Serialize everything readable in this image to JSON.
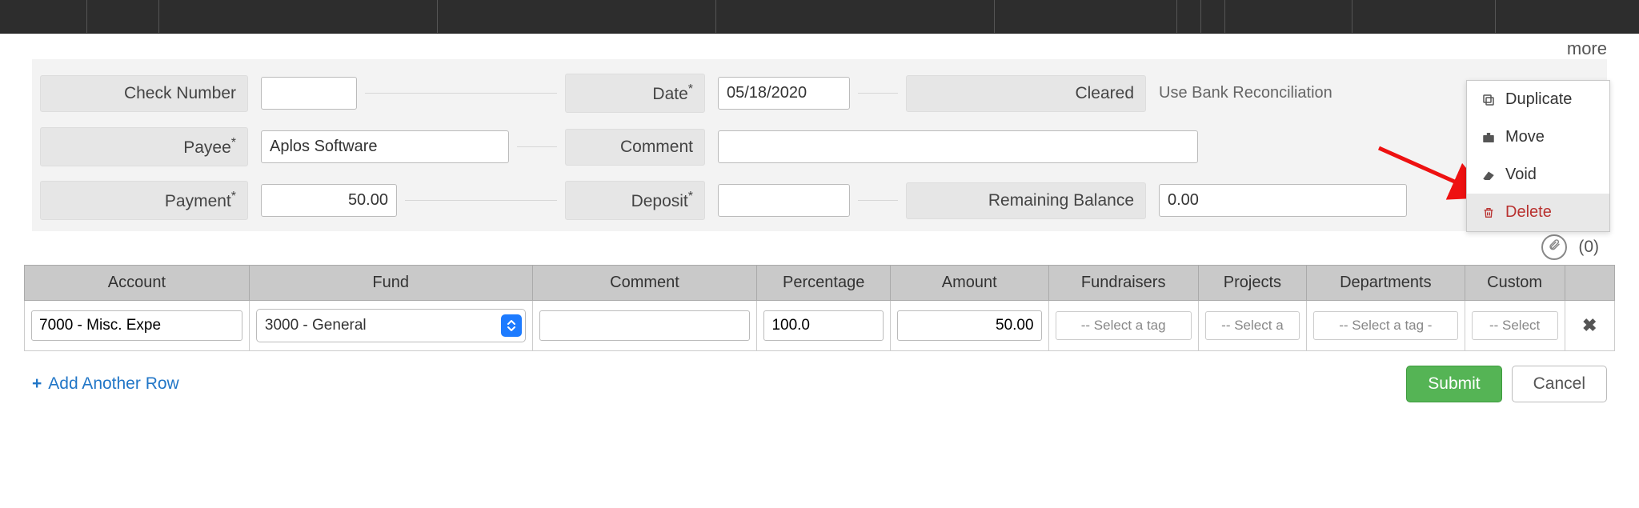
{
  "more_label": "more",
  "form": {
    "check_number": {
      "label": "Check Number",
      "value": ""
    },
    "payee": {
      "label": "Payee",
      "required_mark": "*",
      "value": "Aplos Software"
    },
    "payment": {
      "label": "Payment",
      "required_mark": "*",
      "value": "50.00"
    },
    "date": {
      "label": "Date",
      "required_mark": "*",
      "value": "05/18/2020"
    },
    "comment": {
      "label": "Comment",
      "value": ""
    },
    "deposit": {
      "label": "Deposit",
      "required_mark": "*",
      "value": ""
    },
    "cleared": {
      "label": "Cleared",
      "hint": "Use Bank Reconciliation"
    },
    "remaining": {
      "label": "Remaining Balance",
      "value": "0.00"
    }
  },
  "attachments": {
    "count_display": "(0)"
  },
  "table": {
    "headers": {
      "account": "Account",
      "fund": "Fund",
      "comment": "Comment",
      "percentage": "Percentage",
      "amount": "Amount",
      "fundraisers": "Fundraisers",
      "projects": "Projects",
      "departments": "Departments",
      "custom": "Custom"
    },
    "row": {
      "account": "7000 - Misc. Expe",
      "fund": "3000 - General",
      "comment": "",
      "percentage": "100.0",
      "amount": "50.00",
      "fundraisers_placeholder": "-- Select a tag",
      "projects_placeholder": "-- Select a",
      "departments_placeholder": "-- Select a tag -",
      "custom_placeholder": "-- Select"
    }
  },
  "dropdown": {
    "duplicate": "Duplicate",
    "move": "Move",
    "void": "Void",
    "delete": "Delete"
  },
  "footer": {
    "add_row": "Add Another Row",
    "submit": "Submit",
    "cancel": "Cancel"
  }
}
